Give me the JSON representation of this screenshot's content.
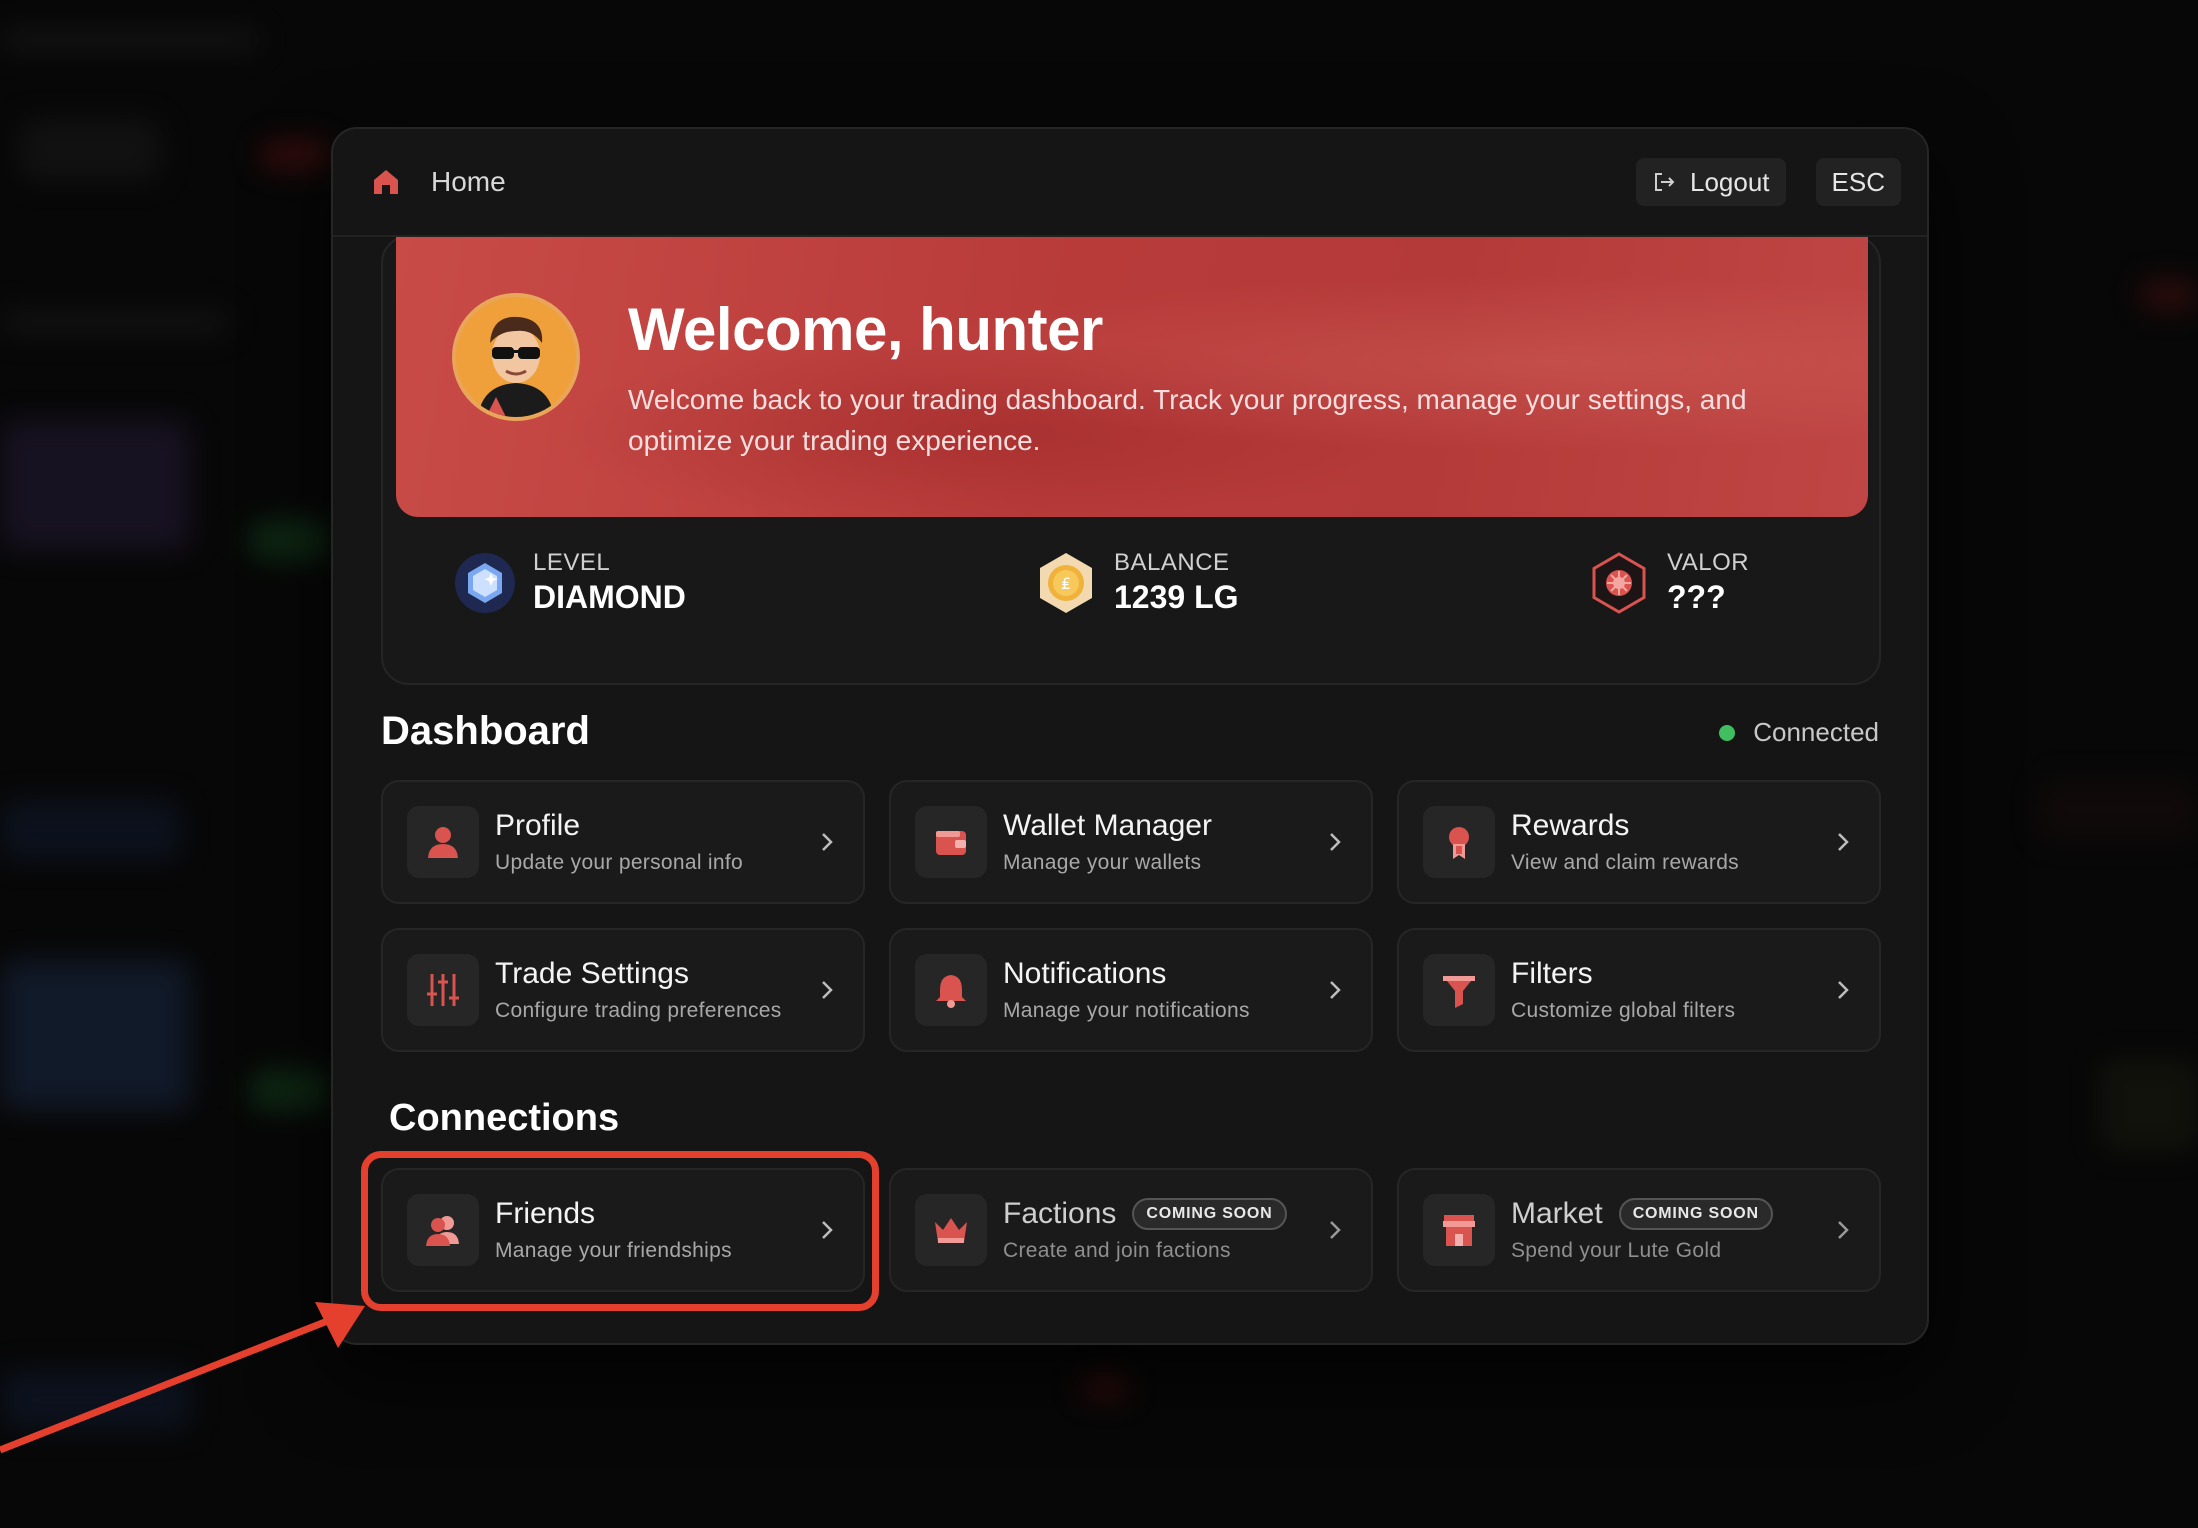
{
  "header": {
    "title": "Home",
    "logout_label": "Logout",
    "esc_label": "ESC"
  },
  "hero": {
    "welcome": "Welcome, hunter",
    "text": "Welcome back to your trading dashboard. Track your progress, manage your settings, and optimize your trading experience."
  },
  "stats": [
    {
      "label": "LEVEL",
      "value": "DIAMOND",
      "icon": "diamond-level-icon"
    },
    {
      "label": "BALANCE",
      "value": "1239 LG",
      "icon": "coin-icon"
    },
    {
      "label": "VALOR",
      "value": "???",
      "icon": "valor-hexagon-icon"
    }
  ],
  "dashboard": {
    "title": "Dashboard",
    "status": "Connected",
    "cards": [
      {
        "title": "Profile",
        "sub": "Update your personal info",
        "icon": "user-icon"
      },
      {
        "title": "Wallet Manager",
        "sub": "Manage your wallets",
        "icon": "wallet-icon"
      },
      {
        "title": "Rewards",
        "sub": "View and claim rewards",
        "icon": "ribbon-icon"
      },
      {
        "title": "Trade Settings",
        "sub": "Configure trading preferences",
        "icon": "sliders-icon"
      },
      {
        "title": "Notifications",
        "sub": "Manage your notifications",
        "icon": "bell-icon"
      },
      {
        "title": "Filters",
        "sub": "Customize global filters",
        "icon": "funnel-icon"
      }
    ]
  },
  "connections": {
    "title": "Connections",
    "cards": [
      {
        "title": "Friends",
        "sub": "Manage your friendships",
        "icon": "users-icon",
        "badge": ""
      },
      {
        "title": "Factions",
        "sub": "Create and join factions",
        "icon": "crown-icon",
        "badge": "COMING SOON"
      },
      {
        "title": "Market",
        "sub": "Spend your Lute Gold",
        "icon": "store-icon",
        "badge": "COMING SOON"
      }
    ]
  },
  "colors": {
    "accent": "#d9534f",
    "hero_red": "#bd4341",
    "annotation": "#e5402d",
    "connected": "#3fbf5f"
  }
}
